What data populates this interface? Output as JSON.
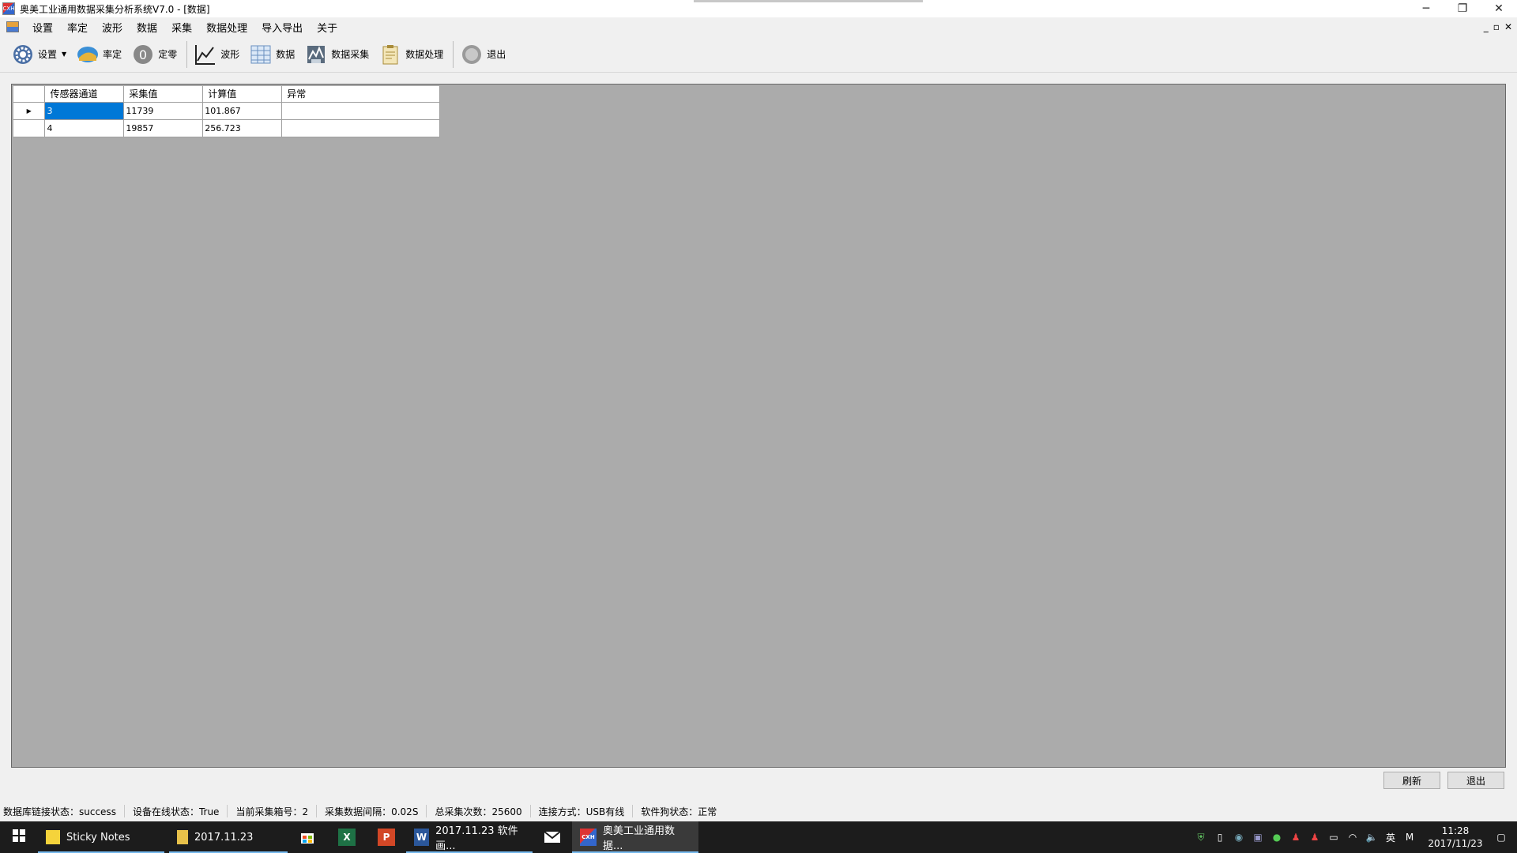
{
  "window": {
    "icon_text": "CXH",
    "title": "奥美工业通用数据采集分析系统V7.0 - [数据]",
    "minimize": "─",
    "restore": "❐",
    "close": "✕"
  },
  "mdi_controls": {
    "minimize": "_",
    "restore": "▫",
    "close": "✕"
  },
  "menu": [
    "设置",
    "率定",
    "波形",
    "数据",
    "采集",
    "数据处理",
    "导入导出",
    "关于"
  ],
  "toolbar": {
    "settings": "设置",
    "calibrate": "率定",
    "zero": "定零",
    "waveform": "波形",
    "data": "数据",
    "data_acquisition": "数据采集",
    "data_processing": "数据处理",
    "exit": "退出"
  },
  "grid": {
    "headers": [
      "传感器通道",
      "采集值",
      "计算值",
      "异常"
    ],
    "rows": [
      {
        "channel": "3",
        "raw": "11739",
        "calc": "101.867",
        "error": ""
      },
      {
        "channel": "4",
        "raw": "19857",
        "calc": "256.723",
        "error": ""
      }
    ],
    "row_indicator": "▶"
  },
  "buttons": {
    "refresh": "刷新",
    "exit": "退出"
  },
  "status": [
    "数据库链接状态：success",
    "设备在线状态：True",
    "当前采集箱号：2",
    "采集数据间隔：0.02S",
    "总采集次数：25600",
    "连接方式：USB有线",
    "软件狗状态：正常"
  ],
  "taskbar": {
    "items": [
      {
        "label": "Sticky Notes"
      },
      {
        "label": "2017.11.23"
      },
      {
        "label": ""
      },
      {
        "label": ""
      },
      {
        "label": ""
      },
      {
        "label": "2017.11.23 软件画..."
      },
      {
        "label": ""
      },
      {
        "label": "奥美工业通用数据..."
      }
    ],
    "ime": "英",
    "time": "11:28",
    "date": "2017/11/23"
  },
  "colors": {
    "selection": "#0078d7",
    "mdi_background": "#ababab",
    "taskbar": "#1c1c1c"
  }
}
